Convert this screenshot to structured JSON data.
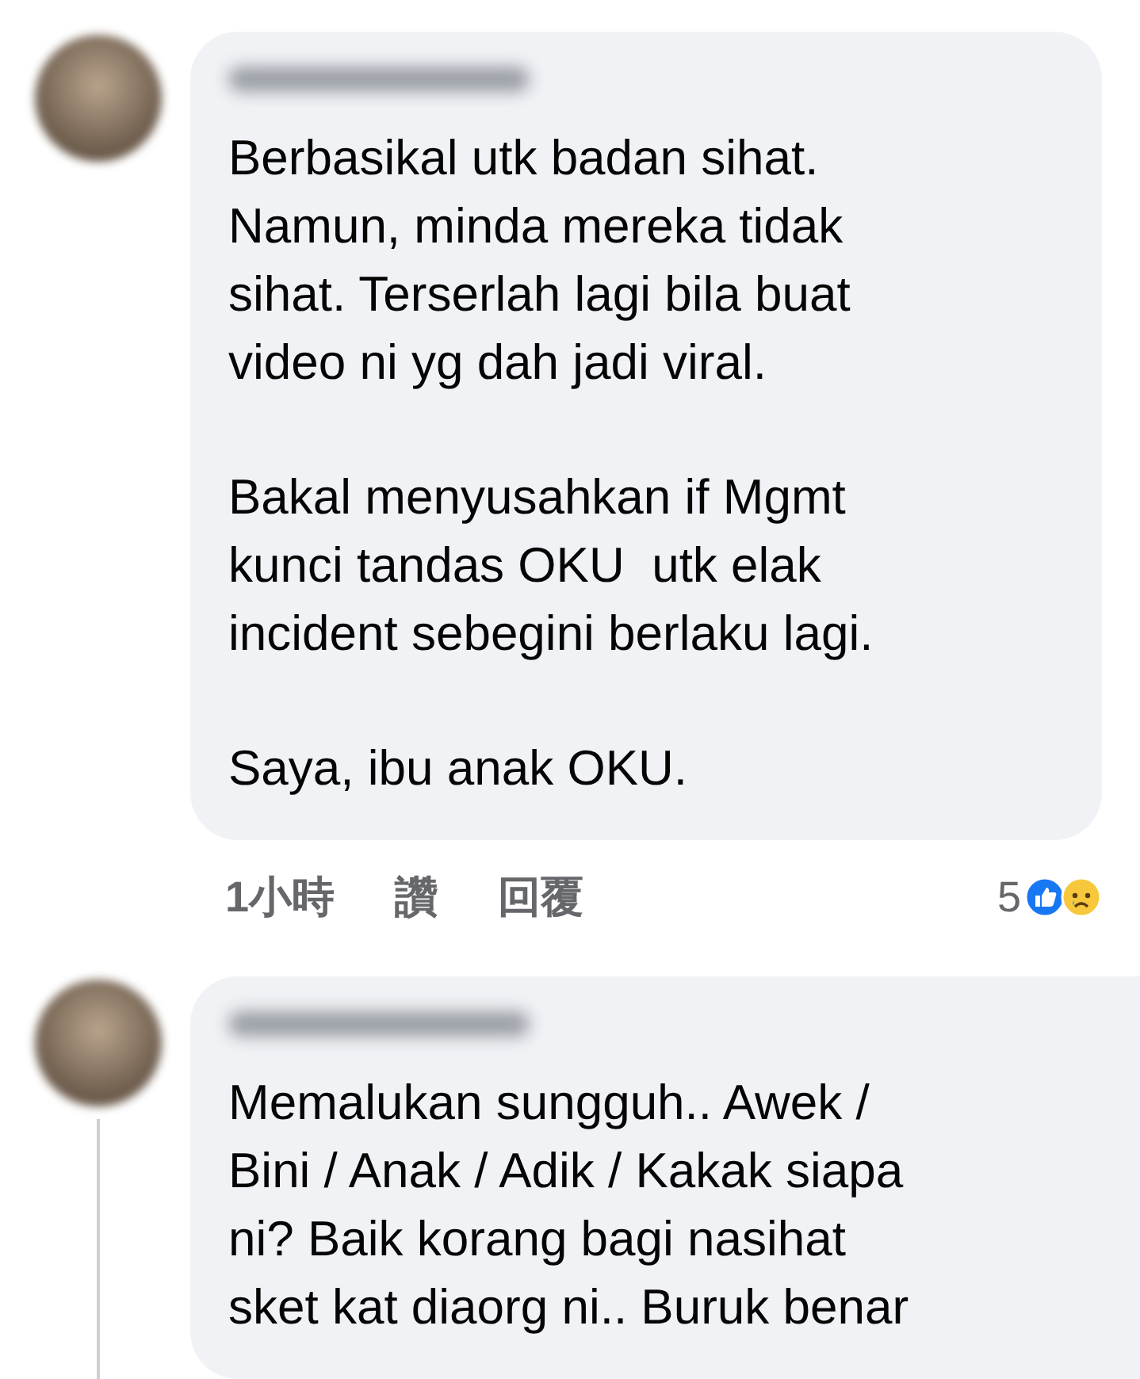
{
  "comments": [
    {
      "paragraphs": [
        "Berbasikal utk badan sihat.\nNamun, minda mereka tidak\nsihat. Terserlah lagi bila buat\nvideo ni yg dah jadi viral.",
        "Bakal menyusahkan if Mgmt\nkunci tandas OKU  utk elak\nincident sebegini berlaku lagi.",
        "Saya, ibu anak OKU."
      ],
      "time": "1小時",
      "like": "讚",
      "reply": "回覆",
      "reaction_count": "5",
      "has_replies": false
    },
    {
      "paragraphs": [
        "Memalukan sungguh.. Awek /\nBini / Anak / Adik / Kakak siapa\nni? Baik korang bagi nasihat\nsket kat diaorg ni.. Buruk benar"
      ],
      "has_replies": true
    }
  ]
}
